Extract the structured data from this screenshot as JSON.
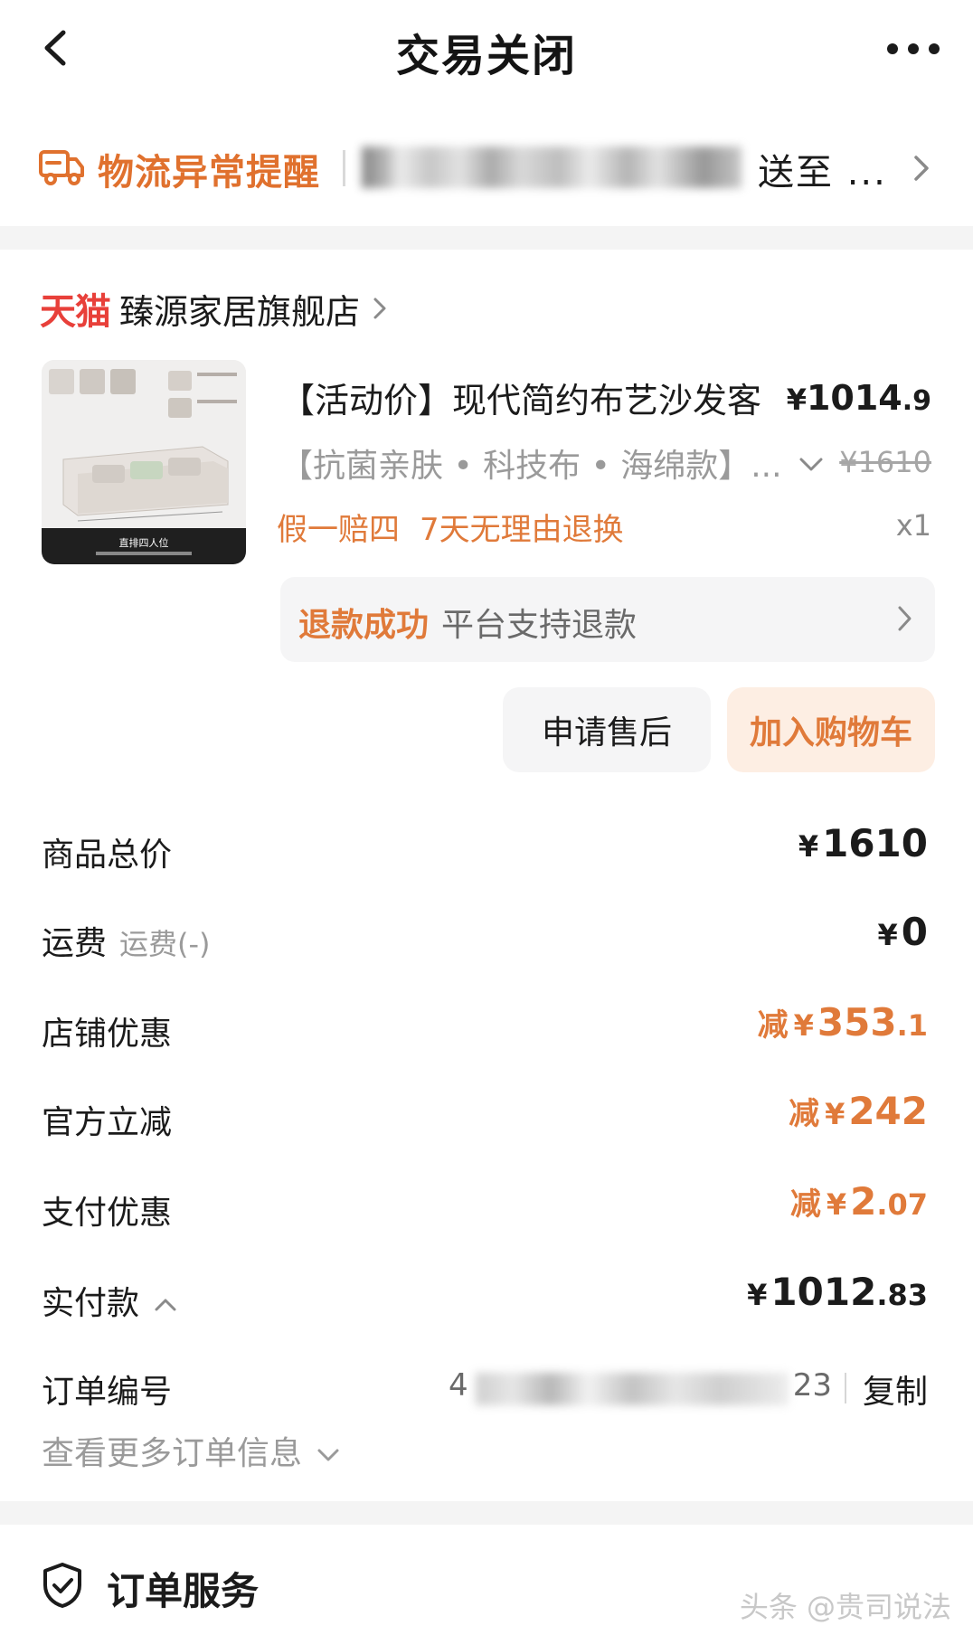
{
  "header": {
    "title": "交易关闭",
    "back_icon": "back-arrow-icon",
    "more_icon": "more-dots-icon"
  },
  "logistics": {
    "title": "物流异常提醒",
    "destination": "送至 ...",
    "icon": "truck-icon"
  },
  "store": {
    "brand": "天猫",
    "name": "臻源家居旗舰店"
  },
  "product": {
    "title": "【活动价】现代简约布艺沙发客",
    "price": {
      "currency": "¥",
      "int": "1014",
      "dec": ".9"
    },
    "spec": "【抗菌亲肤 • 科技布 • 海绵款】...",
    "original_price": "¥1610",
    "tags": [
      "假一赔四",
      "7天无理由退换"
    ],
    "quantity": "x1",
    "image_caption": "直排四人位"
  },
  "refund": {
    "status": "退款成功",
    "description": "平台支持退款"
  },
  "actions": {
    "after_sale": "申请售后",
    "add_to_cart": "加入购物车"
  },
  "summary": {
    "goods_total": {
      "label": "商品总价",
      "currency": "¥",
      "value": "1610"
    },
    "shipping": {
      "label": "运费",
      "sub": "运费(-)",
      "currency": "¥",
      "value": "0"
    },
    "shop_discount": {
      "label": "店铺优惠",
      "prefix": "减",
      "currency": "¥",
      "int": "353",
      "dec": ".1"
    },
    "official_discount": {
      "label": "官方立减",
      "prefix": "减",
      "currency": "¥",
      "value": "242"
    },
    "pay_discount": {
      "label": "支付优惠",
      "prefix": "减",
      "currency": "¥",
      "int": "2",
      "dec": ".07"
    },
    "paid": {
      "label": "实付款",
      "currency": "¥",
      "int": "1012",
      "dec": ".83"
    }
  },
  "order": {
    "number_label": "订单编号",
    "number_head": "4",
    "number_tail": "23",
    "copy_label": "复制",
    "more_info": "查看更多订单信息"
  },
  "service": {
    "label": "订单服务",
    "icon": "shield-check-icon"
  },
  "watermark": "头条 @贵司说法",
  "colors": {
    "accent_orange": "#e07a3a",
    "tmall_red": "#e8403a",
    "text_dark": "#1b1b1b",
    "text_gray": "#9a9a9a"
  }
}
